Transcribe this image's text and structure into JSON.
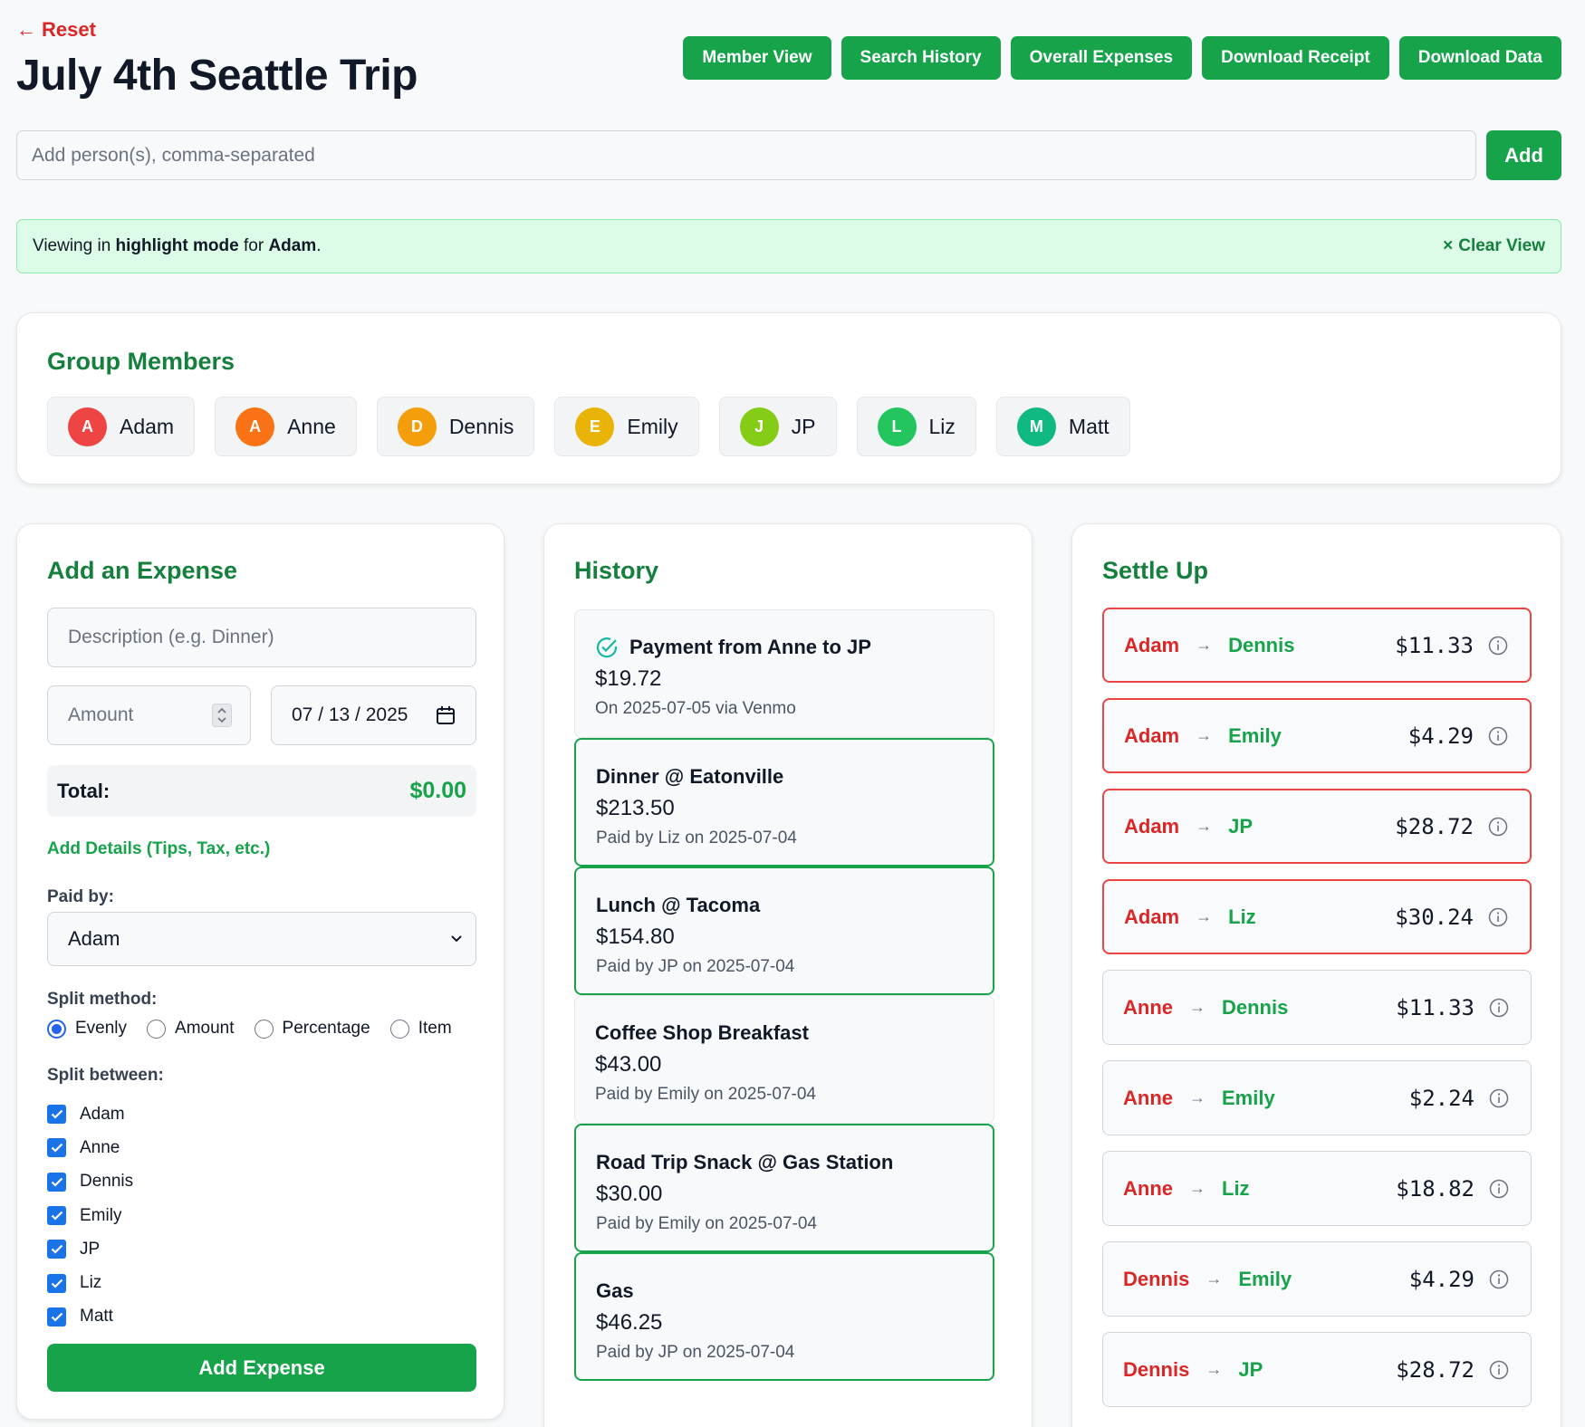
{
  "header": {
    "reset_label": "Reset",
    "title": "July 4th Seattle Trip",
    "actions": [
      "Member View",
      "Search History",
      "Overall Expenses",
      "Download Receipt",
      "Download Data"
    ]
  },
  "add_person": {
    "placeholder": "Add person(s), comma-separated",
    "button": "Add"
  },
  "banner": {
    "prefix": "Viewing in",
    "mode": "highlight mode",
    "middle": "for",
    "member": "Adam",
    "suffix": ".",
    "clear": "Clear View"
  },
  "members": {
    "title": "Group Members",
    "list": [
      {
        "initial": "A",
        "name": "Adam",
        "color": "#ef4444"
      },
      {
        "initial": "A",
        "name": "Anne",
        "color": "#f97316"
      },
      {
        "initial": "D",
        "name": "Dennis",
        "color": "#f59e0b"
      },
      {
        "initial": "E",
        "name": "Emily",
        "color": "#eab308"
      },
      {
        "initial": "J",
        "name": "JP",
        "color": "#84cc16"
      },
      {
        "initial": "L",
        "name": "Liz",
        "color": "#22c55e"
      },
      {
        "initial": "M",
        "name": "Matt",
        "color": "#10b981"
      }
    ]
  },
  "expense_form": {
    "title": "Add an Expense",
    "description_placeholder": "Description (e.g. Dinner)",
    "amount_placeholder": "Amount",
    "date_value": "07 / 13 / 2025",
    "total_label": "Total:",
    "total_value": "$0.00",
    "add_details": "Add Details (Tips, Tax, etc.)",
    "paid_by_label": "Paid by:",
    "paid_by_value": "Adam",
    "split_method_label": "Split method:",
    "split_methods": [
      "Evenly",
      "Amount",
      "Percentage",
      "Item"
    ],
    "split_method_selected": "Evenly",
    "split_between_label": "Split between:",
    "split_between": [
      "Adam",
      "Anne",
      "Dennis",
      "Emily",
      "JP",
      "Liz",
      "Matt"
    ],
    "submit": "Add Expense"
  },
  "history": {
    "title": "History",
    "items": [
      {
        "title": "Payment from Anne to JP",
        "amount": "$19.72",
        "meta": "On 2025-07-05 via Venmo",
        "payment": true,
        "highlight": false
      },
      {
        "title": "Dinner @ Eatonville",
        "amount": "$213.50",
        "meta": "Paid by Liz on 2025-07-04",
        "payment": false,
        "highlight": true
      },
      {
        "title": "Lunch @ Tacoma",
        "amount": "$154.80",
        "meta": "Paid by JP on 2025-07-04",
        "payment": false,
        "highlight": true
      },
      {
        "title": "Coffee Shop Breakfast",
        "amount": "$43.00",
        "meta": "Paid by Emily on 2025-07-04",
        "payment": false,
        "highlight": false
      },
      {
        "title": "Road Trip Snack @ Gas Station",
        "amount": "$30.00",
        "meta": "Paid by Emily on 2025-07-04",
        "payment": false,
        "highlight": true
      },
      {
        "title": "Gas",
        "amount": "$46.25",
        "meta": "Paid by JP on 2025-07-04",
        "payment": false,
        "highlight": true
      }
    ]
  },
  "settle": {
    "title": "Settle Up",
    "items": [
      {
        "from": "Adam",
        "to": "Dennis",
        "amount": "$11.33",
        "highlight": true
      },
      {
        "from": "Adam",
        "to": "Emily",
        "amount": "$4.29",
        "highlight": true
      },
      {
        "from": "Adam",
        "to": "JP",
        "amount": "$28.72",
        "highlight": true
      },
      {
        "from": "Adam",
        "to": "Liz",
        "amount": "$30.24",
        "highlight": true
      },
      {
        "from": "Anne",
        "to": "Dennis",
        "amount": "$11.33",
        "highlight": false
      },
      {
        "from": "Anne",
        "to": "Emily",
        "amount": "$2.24",
        "highlight": false
      },
      {
        "from": "Anne",
        "to": "Liz",
        "amount": "$18.82",
        "highlight": false
      },
      {
        "from": "Dennis",
        "to": "Emily",
        "amount": "$4.29",
        "highlight": false
      },
      {
        "from": "Dennis",
        "to": "JP",
        "amount": "$28.72",
        "highlight": false
      }
    ]
  },
  "colors": {
    "accent": "#16a34a",
    "danger": "#dc2626",
    "banner_bg": "#dcfce7"
  }
}
